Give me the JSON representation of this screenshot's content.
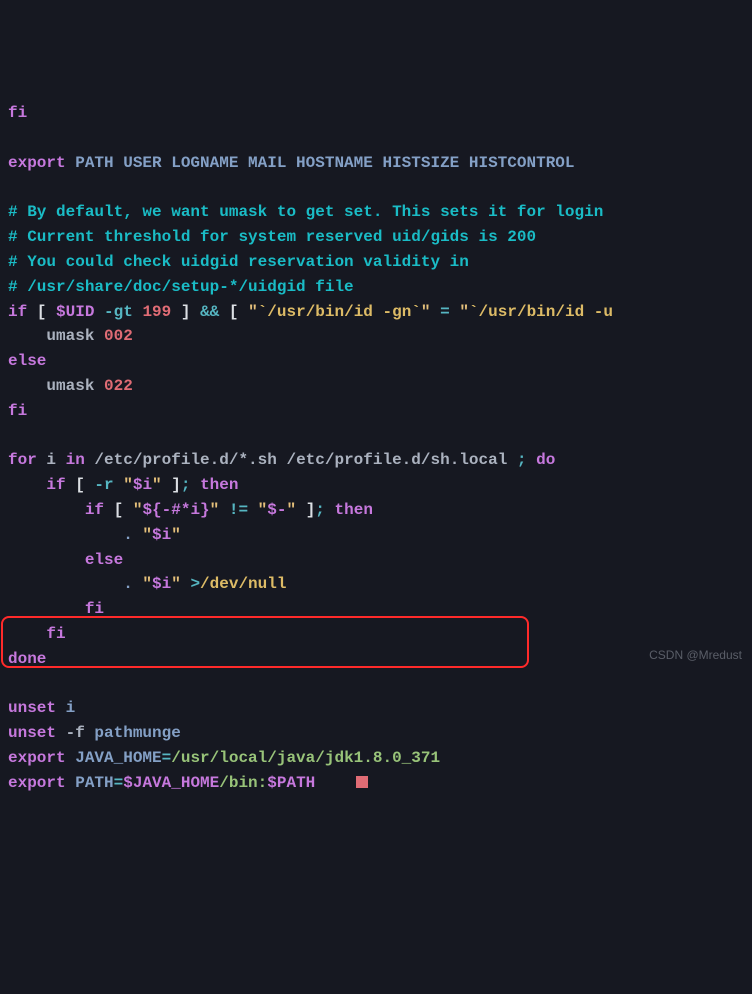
{
  "l1": "fi",
  "l2a": "export",
  "l2b": " PATH USER LOGNAME MAIL HOSTNAME HISTSIZE HISTCONTROL",
  "l3": "# By default, we want umask to get set. This sets it for login",
  "l4": "# Current threshold for system reserved uid/gids is 200",
  "l5": "# You could check uidgid reservation validity in",
  "l6": "# /usr/share/doc/setup-*/uidgid file",
  "l7_if": "if",
  "l7_lb": " [ ",
  "l7_uid": "$UID",
  "l7_gt": " -gt ",
  "l7_199": "199",
  "l7_rb": " ] ",
  "l7_and": "&&",
  "l7_lb2": " [ ",
  "l7_q1": "\"",
  "l7_cmd1": "`/usr/bin/id -gn`",
  "l7_q2": "\"",
  "l7_eq": " = ",
  "l7_q3": "\"",
  "l7_cmd2": "`/usr/bin/id -u",
  "l7_q4": "",
  "l8a": "    umask ",
  "l8b": "002",
  "l9": "else",
  "l10a": "    umask ",
  "l10b": "022",
  "l11": "fi",
  "l12_for": "for",
  "l12_i": " i ",
  "l12_in": "in",
  "l12_paths": " /etc/profile.d/*.sh /etc/profile.d/sh.local ",
  "l12_semi": ";",
  "l12_do": " do",
  "l13a": "    ",
  "l13_if": "if",
  "l13_lb": " [ ",
  "l13_r": "-r ",
  "l13_q1": "\"",
  "l13_var": "$i",
  "l13_q2": "\"",
  "l13_rb": " ]",
  "l13_semi": ";",
  "l13_then": " then",
  "l14a": "        ",
  "l14_if": "if",
  "l14_lb": " [ ",
  "l14_q1": "\"",
  "l14_var": "${-#*i}",
  "l14_q2": "\"",
  "l14_ne": " != ",
  "l14_q3": "\"",
  "l14_str": "$-",
  "l14_q4": "\"",
  "l14_rb": " ]",
  "l14_semi": ";",
  "l14_then": " then",
  "l15a": "            ",
  "l15_dot": ". ",
  "l15_q1": "\"",
  "l15_var": "$i",
  "l15_q2": "\"",
  "l16": "        else",
  "l17a": "            ",
  "l17_dot": ". ",
  "l17_q1": "\"",
  "l17_var": "$i",
  "l17_q2": "\"",
  "l17_gt": " >",
  "l17_dev": "/dev/null",
  "l18": "        fi",
  "l19": "    fi",
  "l20": "done",
  "l21a": "unset",
  "l21b": " i",
  "l22a": "unset",
  "l22b": " -f ",
  "l22c": "pathmunge",
  "l23a": "export",
  "l23b": " JAVA_HOME",
  "l23eq": "=",
  "l23c": "/usr/local/java/jdk1.8.0_371",
  "l24a": "export",
  "l24b": " PATH",
  "l24eq": "=",
  "l24c": "$JAVA_HOME",
  "l24d": "/bin:",
  "l24e": "$PATH",
  "watermark": "CSDN @Mredust"
}
